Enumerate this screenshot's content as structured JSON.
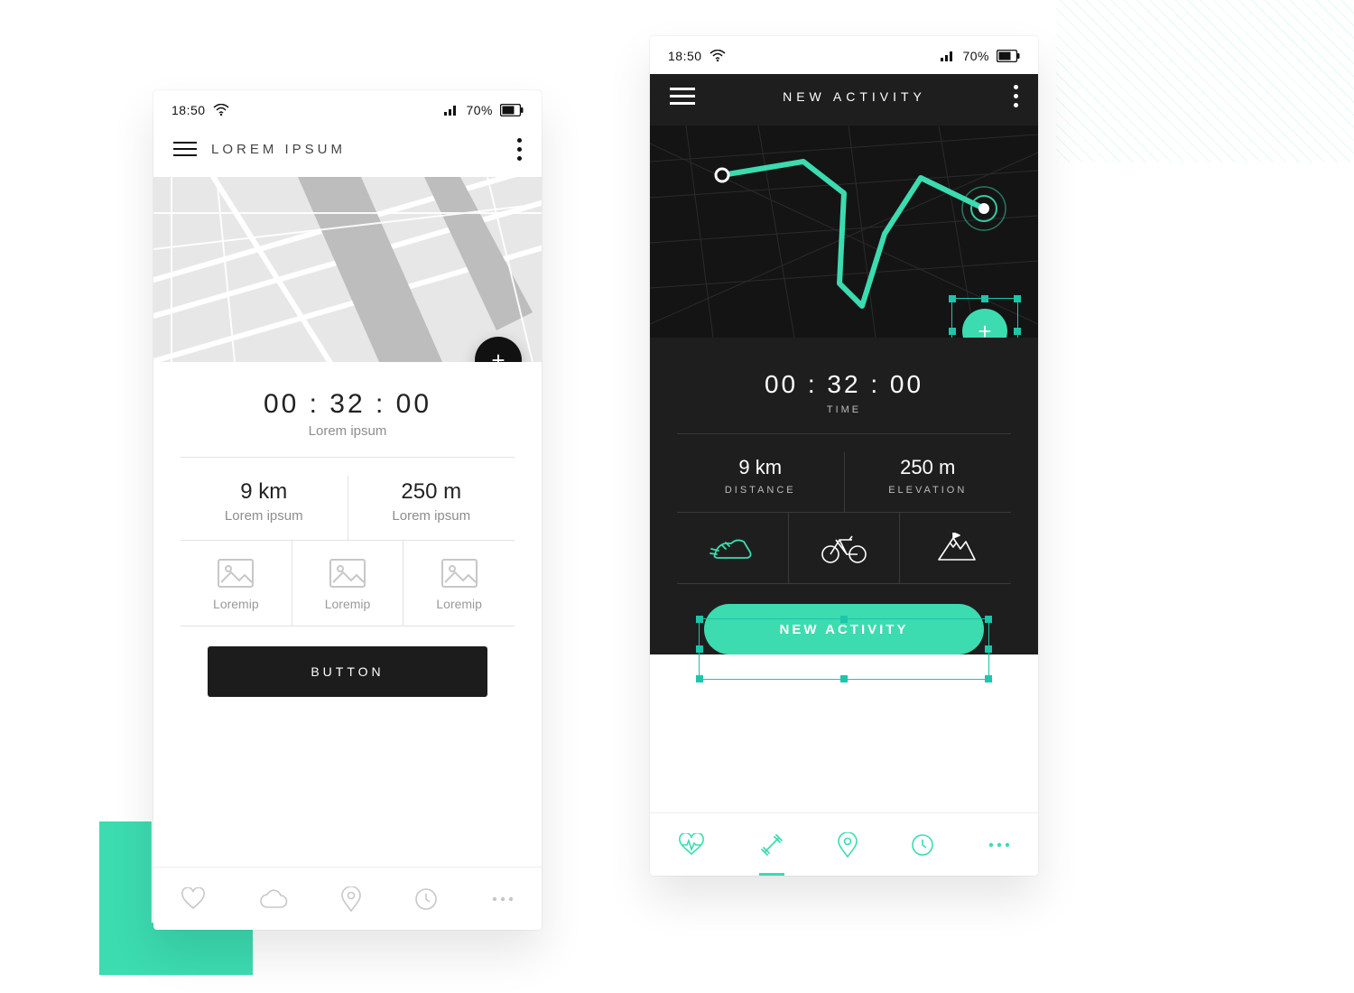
{
  "status": {
    "time": "18:50",
    "battery": "70%"
  },
  "light": {
    "title": "LOREM IPSUM",
    "timer": "00 : 32 : 00",
    "timer_label": "Lorem ipsum",
    "dist_val": "9 km",
    "dist_label": "Lorem ipsum",
    "elev_val": "250 m",
    "elev_label": "Lorem ipsum",
    "act1": "Loremip",
    "act2": "Loremip",
    "act3": "Loremip",
    "button": "BUTTON",
    "fab": "+"
  },
  "dark": {
    "title": "NEW ACTIVITY",
    "timer": "00 : 32 : 00",
    "timer_label": "TIME",
    "dist_val": "9 km",
    "dist_label": "DISTANCE",
    "elev_val": "250 m",
    "elev_label": "ELEVATION",
    "button": "NEW ACTIVITY",
    "fab": "+",
    "accent": "#3cdbb0"
  }
}
